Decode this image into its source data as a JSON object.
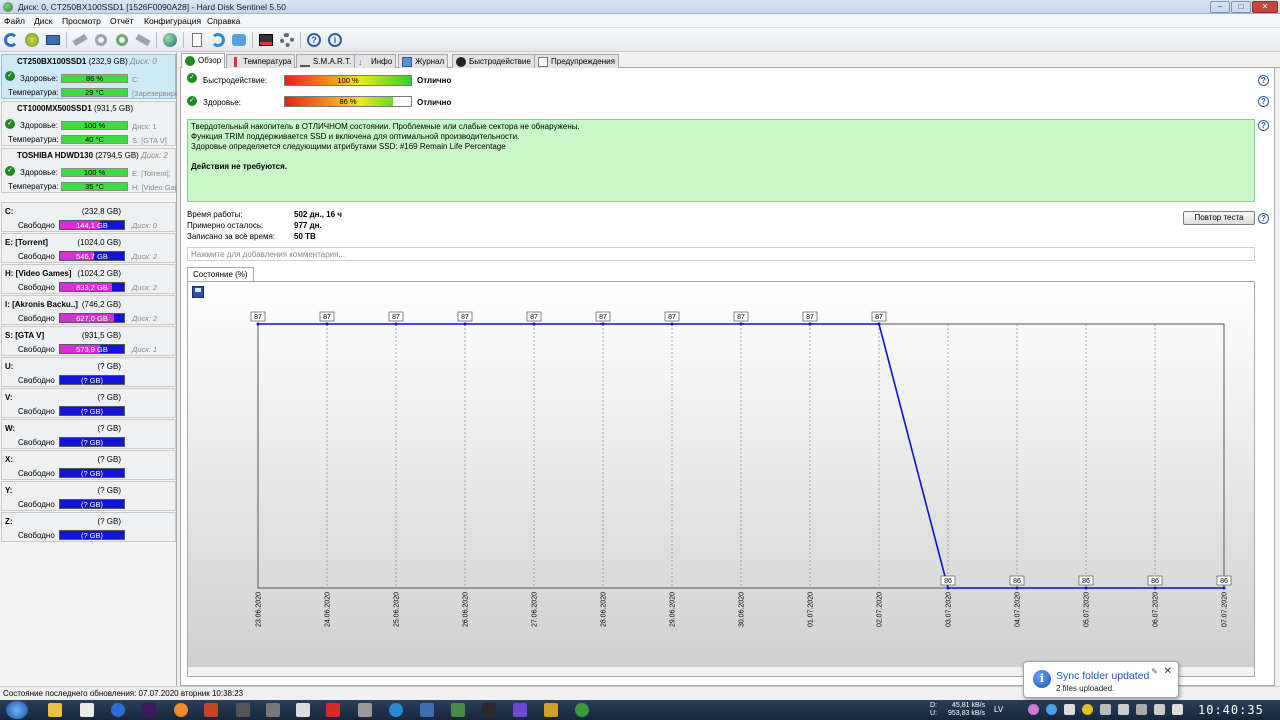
{
  "window": {
    "title": "Диск: 0, CT250BX100SSD1 [1526F0090A28]  -  Hard Disk Sentinel 5.50"
  },
  "menu": [
    "Файл",
    "Диск",
    "Просмотр",
    "Отчёт",
    "Конфигурация",
    "Справка"
  ],
  "disks": [
    {
      "name": "CT250BX100SSD1",
      "size": "(232,9 GB)",
      "disk_no": "Диск: 0",
      "health_label": "Здоровье:",
      "health": "86 %",
      "health_hint": "C:",
      "temp_label": "Температура:",
      "temp": "29 °C",
      "temp_hint": "[Зарезервировано]"
    },
    {
      "name": "CT1000MX500SSD1",
      "size": "(931,5 GB)",
      "disk_no": "",
      "health_label": "Здоровье:",
      "health": "100 %",
      "health_hint": "Диск: 1",
      "temp_label": "Температура:",
      "temp": "40 °C",
      "temp_hint": "S: [GTA V]"
    },
    {
      "name": "TOSHIBA HDWD130",
      "size": "(2794,5 GB)",
      "disk_no": "Диск: 2",
      "health_label": "Здоровье:",
      "health": "100 %",
      "health_hint": "E: [Torrent],",
      "temp_label": "Температура:",
      "temp": "35 °C",
      "temp_hint": "H: [Video Games]"
    }
  ],
  "volumes": [
    {
      "name": "C:",
      "size": "(232,8 GB)",
      "free_label": "Свободно",
      "free": "144,1 GB",
      "free_fraction": 0.62,
      "disk": "Диск: 0"
    },
    {
      "name": "E: [Torrent]",
      "size": "(1024,0 GB)",
      "free_label": "Свободно",
      "free": "546,7 GB",
      "free_fraction": 0.53,
      "disk": "Диск: 2"
    },
    {
      "name": "H: [Video Games]",
      "size": "(1024,2 GB)",
      "free_label": "Свободно",
      "free": "833,2 GB",
      "free_fraction": 0.81,
      "disk": "Диск: 2"
    },
    {
      "name": "I: [Akronis Backu..]",
      "size": "(746,2 GB)",
      "free_label": "Свободно",
      "free": "627,0 GB",
      "free_fraction": 0.84,
      "disk": "Диск: 2"
    },
    {
      "name": "S: [GTA V]",
      "size": "(931,5 GB)",
      "free_label": "Свободно",
      "free": "573,9 GB",
      "free_fraction": 0.62,
      "disk": "Диск: 1"
    },
    {
      "name": "U:",
      "size": "(? GB)",
      "free_label": "Свободно",
      "free": "(? GB)",
      "free_fraction": 0,
      "disk": ""
    },
    {
      "name": "V:",
      "size": "(? GB)",
      "free_label": "Свободно",
      "free": "(? GB)",
      "free_fraction": 0,
      "disk": ""
    },
    {
      "name": "W:",
      "size": "(? GB)",
      "free_label": "Свободно",
      "free": "(? GB)",
      "free_fraction": 0,
      "disk": ""
    },
    {
      "name": "X:",
      "size": "(? GB)",
      "free_label": "Свободно",
      "free": "(? GB)",
      "free_fraction": 0,
      "disk": ""
    },
    {
      "name": "Y:",
      "size": "(? GB)",
      "free_label": "Свободно",
      "free": "(? GB)",
      "free_fraction": 0,
      "disk": ""
    },
    {
      "name": "Z:",
      "size": "(? GB)",
      "free_label": "Свободно",
      "free": "(? GB)",
      "free_fraction": 0,
      "disk": ""
    }
  ],
  "tabs": [
    "Обзор",
    "Температура",
    "S.M.A.R.T.",
    "Инфо",
    "Журнал",
    "Быстродействие",
    "Предупреждения"
  ],
  "overview": {
    "perf_label": "Быстродействие:",
    "perf_value": "100 %",
    "perf_fraction": 1.0,
    "perf_status": "Отлично",
    "health_label": "Здоровье:",
    "health_value": "86 %",
    "health_fraction": 0.86,
    "health_status": "Отлично",
    "message_lines": [
      "Твердотельный накопитель в ОТЛИЧНОМ состоянии. Проблемные или слабые сектора не обнаружены.",
      "Функция TRIM поддерживается SSD и включена для оптимальной производительности.",
      "Здоровье определяется следующими атрибутами SSD: #169 Remain Life Percentage"
    ],
    "message_action": "Действия не требуются.",
    "uptime_label": "Время работы:",
    "uptime": "502 дн., 16 ч",
    "remaining_label": "Примерно осталось:",
    "remaining": "977 дн.",
    "written_label": "Записано за всё время:",
    "written": "50 TB",
    "retest_button": "Повтор теста",
    "comment_placeholder": "Нажмите для добавления комментария...",
    "chart_tab": "Состояние (%)"
  },
  "chart_data": {
    "type": "line",
    "title": "",
    "xlabel": "",
    "ylabel": "",
    "x": [
      "23.06.2020",
      "24.06.2020",
      "25.06.2020",
      "26.06.2020",
      "27.06.2020",
      "28.06.2020",
      "29.06.2020",
      "30.06.2020",
      "01.07.2020",
      "02.07.2020",
      "03.07.2020",
      "04.07.2020",
      "05.07.2020",
      "06.07.2020",
      "07.07.2020"
    ],
    "values": [
      87,
      87,
      87,
      87,
      87,
      87,
      87,
      87,
      87,
      87,
      86,
      86,
      86,
      86,
      86
    ],
    "ylim": [
      86,
      87
    ],
    "grid": "vertical dashed",
    "color": "#1010d0"
  },
  "status": {
    "text": "Состояние последнего обновления: 07.07.2020 вторник 10:38:23"
  },
  "tray": {
    "down_label": "D:",
    "down": "45,81 kB/s",
    "up_label": "U:",
    "up": "953,83 kB/s",
    "lang": "LV",
    "clock": "10:40:35"
  },
  "toast": {
    "title": "Sync folder updated",
    "message": "2 files uploaded."
  },
  "colors": {
    "accent": "#1d58b5",
    "health_green": "#3fdc3f",
    "volume_used": "#1414d6",
    "volume_free": "#d62fd6",
    "message_bg": "#c8f7c8"
  }
}
